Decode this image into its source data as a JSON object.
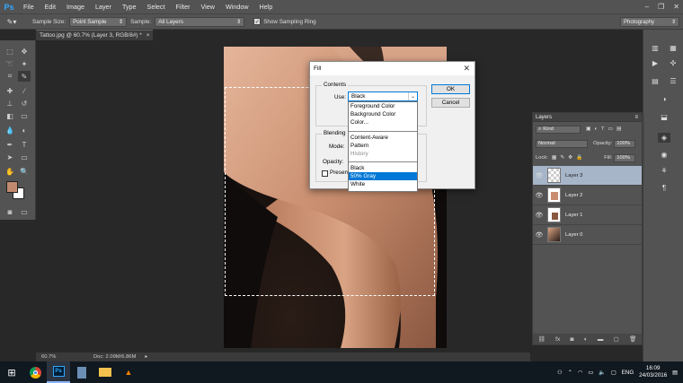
{
  "app": {
    "logo": "Ps"
  },
  "menubar": {
    "items": [
      "File",
      "Edit",
      "Image",
      "Layer",
      "Type",
      "Select",
      "Filter",
      "View",
      "Window",
      "Help"
    ]
  },
  "options": {
    "sample_size_label": "Sample Size:",
    "sample_size_value": "Point Sample",
    "sample_label": "Sample:",
    "sample_value": "All Layers",
    "show_ring_label": "Show Sampling Ring",
    "workspace": "Photography"
  },
  "document": {
    "tab_title": "Tattoo.jpg @ 60.7% (Layer 3, RGB/8#) *",
    "zoom": "60.7%",
    "doc_size": "Doc: 2.09M/6.86M"
  },
  "layers_panel": {
    "title": "Layers",
    "kind_label": "Kind",
    "blend_mode": "Normal",
    "opacity_label": "Opacity:",
    "opacity_value": "100%",
    "lock_label": "Lock:",
    "fill_label": "Fill:",
    "fill_value": "100%",
    "layers": [
      {
        "name": "Layer 3",
        "selected": true
      },
      {
        "name": "Layer 2",
        "selected": false
      },
      {
        "name": "Layer 1",
        "selected": false
      },
      {
        "name": "Layer 0",
        "selected": false
      }
    ],
    "footer_icons": [
      "link-icon",
      "fx-icon",
      "mask-icon",
      "adjustment-icon",
      "group-icon",
      "new-layer-icon",
      "trash-icon"
    ]
  },
  "fill_dialog": {
    "title": "Fill",
    "contents_label": "Contents",
    "use_label": "Use:",
    "use_value": "Black",
    "blending_label": "Blending",
    "mode_label": "Mode:",
    "opacity_label": "Opacity:",
    "preserve_label": "Preserve Transparency",
    "ok_label": "OK",
    "cancel_label": "Cancel",
    "dropdown": {
      "group1": [
        "Foreground Color",
        "Background Color",
        "Color..."
      ],
      "group2": [
        "Content-Aware",
        "Pattern",
        "History"
      ],
      "group3": [
        "Black",
        "50% Gray",
        "White"
      ],
      "highlighted": "50% Gray",
      "disabled": "History"
    }
  },
  "taskbar": {
    "language": "ENG",
    "time": "16:09",
    "date": "24/03/2016"
  },
  "colors": {
    "foreground_swatch": "#c18a6e",
    "background_swatch": "#ffffff",
    "accent": "#0078d7",
    "selected_layer": "#a7b5c9"
  }
}
